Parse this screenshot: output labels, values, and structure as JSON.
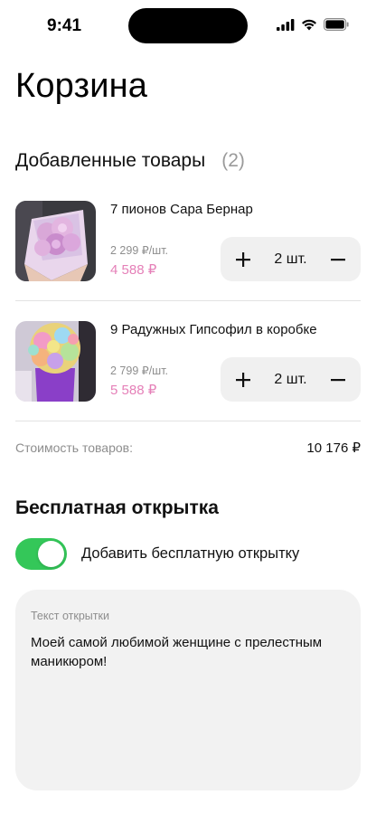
{
  "status_bar": {
    "time": "9:41"
  },
  "page": {
    "title": "Корзина"
  },
  "cart": {
    "section_title": "Добавленные товары",
    "count": "(2)",
    "items": [
      {
        "name": "7 пионов Сара Бернар",
        "unit_price": "2 299 ₽/шт.",
        "total_price": "4 588 ₽",
        "quantity": "2 шт.",
        "image": "pink-peonies-bouquet"
      },
      {
        "name": "9 Радужных Гипсофил в коробке",
        "unit_price": "2 799 ₽/шт.",
        "total_price": "5 588 ₽",
        "quantity": "2 шт.",
        "image": "rainbow-gypsophila-box"
      }
    ],
    "subtotal_label": "Стоимость товаров:",
    "subtotal_value": "10 176 ₽"
  },
  "card": {
    "title": "Бесплатная открытка",
    "toggle_label": "Добавить бесплатную открытку",
    "toggle_on": true,
    "text_label": "Текст открытки",
    "text_value": "Моей самой любимой женщине с прелестным маникюром!"
  },
  "colors": {
    "accent_price": "#e580b8",
    "toggle_on": "#34c759",
    "muted": "#8e8e8e"
  }
}
